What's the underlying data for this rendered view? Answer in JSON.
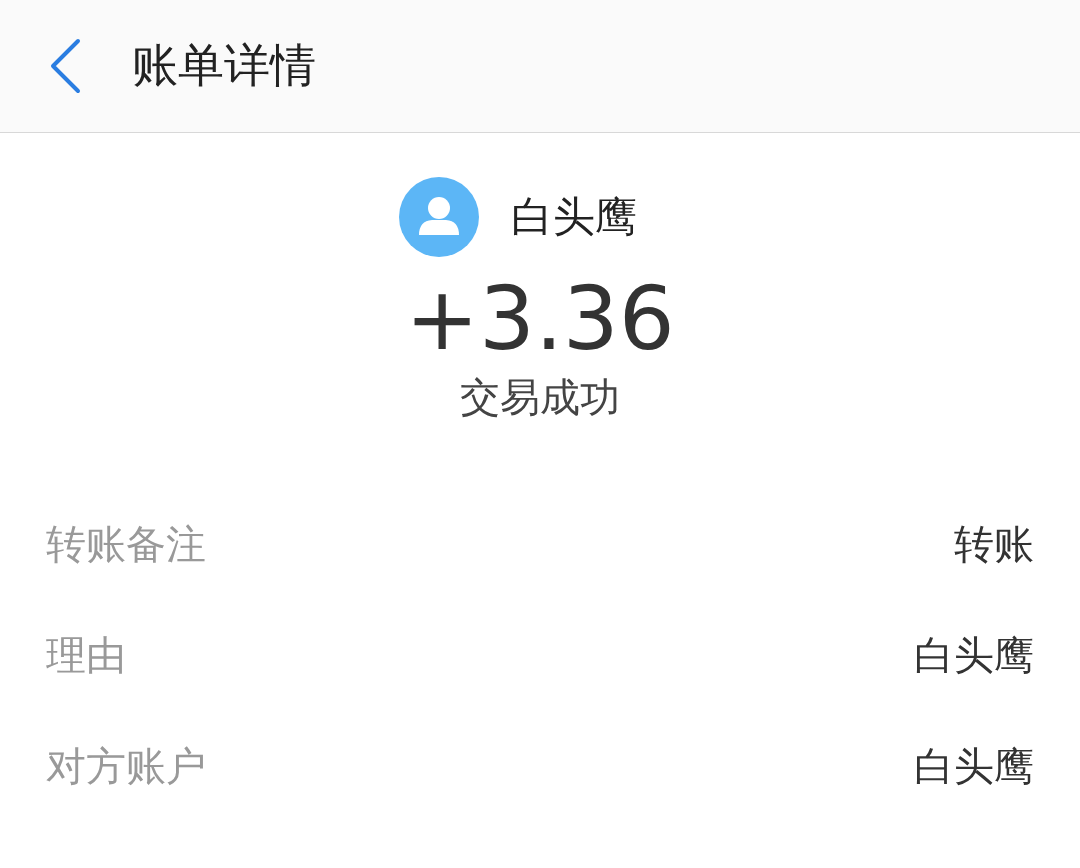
{
  "header": {
    "title": "账单详情"
  },
  "payee": {
    "name": "白头鹰"
  },
  "amount": "+3.36",
  "status": "交易成功",
  "details": [
    {
      "label": "转账备注",
      "value": "转账"
    },
    {
      "label": "理由",
      "value": "白头鹰"
    },
    {
      "label": "对方账户",
      "value": "白头鹰"
    }
  ]
}
